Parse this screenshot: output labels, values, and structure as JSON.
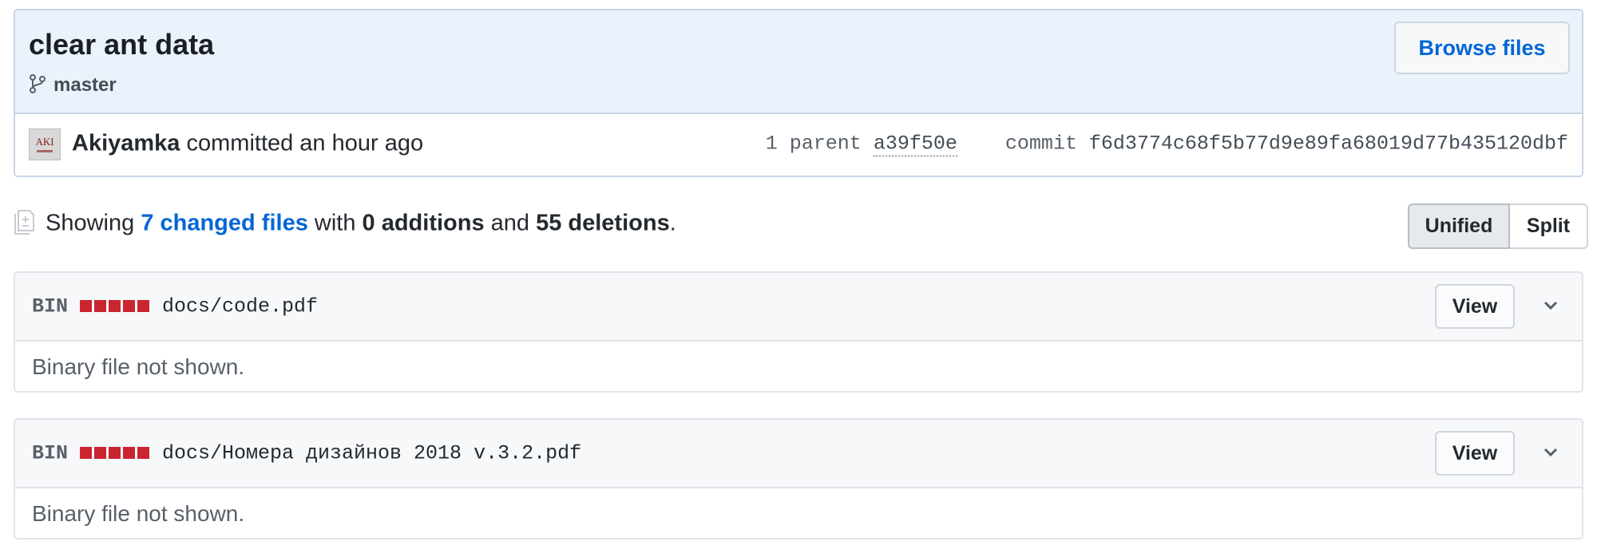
{
  "commit": {
    "title": "clear ant data",
    "branch": "master",
    "browse_label": "Browse files",
    "author": "Akiyamka",
    "committed_text": " committed an hour ago",
    "avatar_text": "AKI",
    "parent_label": "1 parent",
    "parent_sha": "a39f50e",
    "commit_label": "commit",
    "sha": "f6d3774c68f5b77d9e89fa68019d77b435120dbf"
  },
  "toc": {
    "showing": "Showing ",
    "changed_files": "7 changed files",
    "with": " with ",
    "additions": "0 additions",
    "and": " and ",
    "deletions": "55 deletions",
    "period": "."
  },
  "view_modes": {
    "unified": "Unified",
    "split": "Split",
    "selected": "Unified"
  },
  "files": [
    {
      "badge": "BIN",
      "path": "docs/code.pdf",
      "view_label": "View",
      "body": "Binary file not shown."
    },
    {
      "badge": "BIN",
      "path": "docs/Номера дизайнов 2018 v.3.2.pdf",
      "view_label": "View",
      "body": "Binary file not shown."
    }
  ],
  "colors": {
    "link": "#0366d6",
    "deletion": "#cb2431",
    "header_bg": "#eaf2fc"
  },
  "icons": {
    "branch": "git-branch-icon",
    "diff": "file-diff-icon",
    "chevron": "chevron-down-icon"
  }
}
